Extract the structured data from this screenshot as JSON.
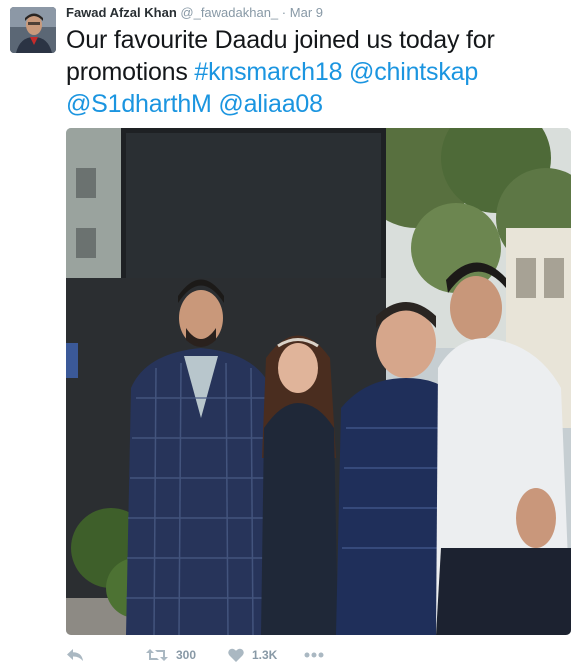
{
  "tweet": {
    "author_name": "Fawad Afzal Khan",
    "author_handle": "@_fawadakhan_",
    "separator": "·",
    "date": "Mar 9",
    "text_plain": "Our favourite Daadu joined us today for promotions ",
    "hashtags": [
      "#knsmarch18",
      "@chintskap",
      "@S1dharthM",
      "@aliaa08"
    ],
    "retweet_count": "300",
    "like_count": "1.3K"
  },
  "icons": {
    "reply": "reply-icon",
    "retweet": "retweet-icon",
    "like": "heart-icon",
    "more": "more-icon"
  },
  "colors": {
    "link": "#1b95e0",
    "muted": "#8899a6",
    "text": "#14171a"
  }
}
